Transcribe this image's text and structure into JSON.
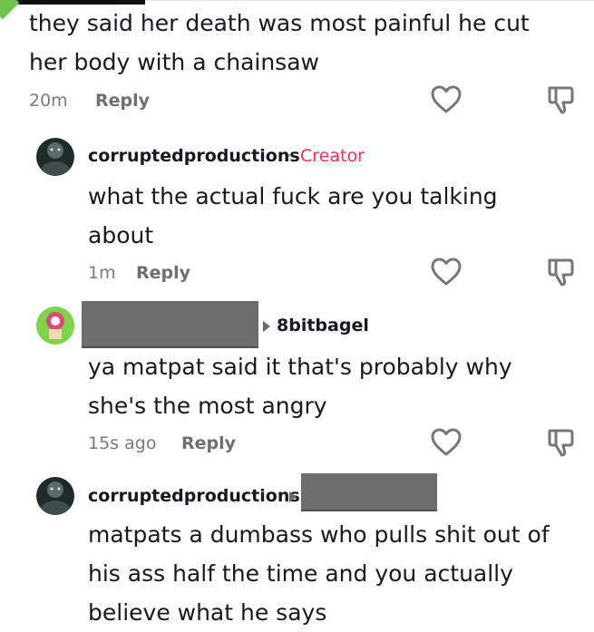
{
  "comments": [
    {
      "text": "they said her death was most painful he cut her body with a chainsaw",
      "time": "20m",
      "reply_label": "Reply"
    },
    {
      "username": "corruptedproductions",
      "separator": "·",
      "badge": "Creator",
      "text": "what the actual fuck are you talking about",
      "time": "1m",
      "reply_label": "Reply"
    },
    {
      "reply_to": "8bitbagel",
      "text": "ya matpat said it that's probably why she's the most angry",
      "time": "15s ago",
      "reply_label": "Reply"
    },
    {
      "username": "corruptedproductions",
      "text": "matpats a dumbass who pulls shit out of his ass half the time and you actually believe what he says"
    }
  ],
  "colors": {
    "creator_badge": "#fe2c55",
    "redaction": "#6d6d6d",
    "secondary_text": "#7a7a7a"
  },
  "icons": {
    "like": "heart-outline-icon",
    "dislike": "thumbs-down-outline-icon"
  }
}
